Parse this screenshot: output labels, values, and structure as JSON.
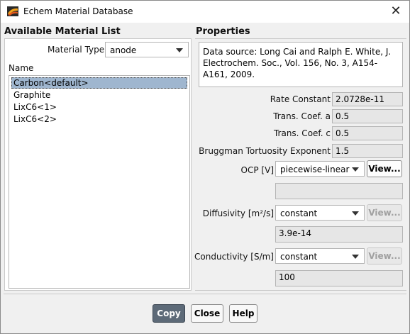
{
  "window": {
    "title": "Echem Material Database"
  },
  "left": {
    "heading": "Available Material List",
    "material_type_label": "Material Type",
    "material_type_value": "anode",
    "name_label": "Name",
    "items": [
      "Carbon<default>",
      "Graphite",
      "LixC6<1>",
      "LixC6<2>"
    ],
    "selected_index": 0
  },
  "right": {
    "heading": "Properties",
    "source": "Data source: Long Cai and Ralph E. White, J. Electrochem. Soc., Vol. 156, No. 3, A154-A161, 2009.",
    "rate_constant_label": "Rate Constant",
    "rate_constant_value": "2.0728e-11",
    "trans_a_label": "Trans. Coef. a",
    "trans_a_value": "0.5",
    "trans_c_label": "Trans. Coef. c",
    "trans_c_value": "0.5",
    "bruggman_label": "Bruggman Tortuosity Exponent",
    "bruggman_value": "1.5",
    "ocp_label": "OCP [V]",
    "ocp_value": "piecewise-linear",
    "ocp_view": "View...",
    "ocp_field": "",
    "diff_label": "Diffusivity [m²/s]",
    "diff_value": "constant",
    "diff_view": "View...",
    "diff_field": "3.9e-14",
    "cond_label": "Conductivity [S/m]",
    "cond_value": "constant",
    "cond_view": "View...",
    "cond_field": "100"
  },
  "buttons": {
    "copy": "Copy",
    "close": "Close",
    "help": "Help"
  }
}
